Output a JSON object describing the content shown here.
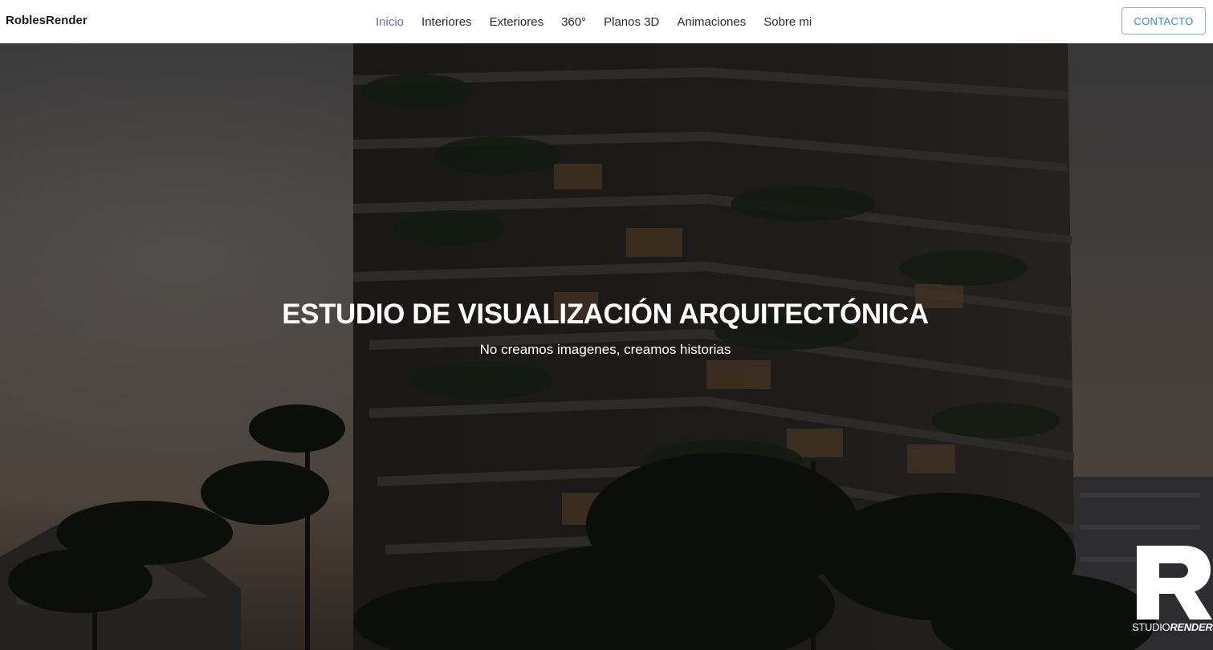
{
  "brand": {
    "name": "RoblesRender"
  },
  "nav": {
    "items": [
      {
        "label": "Inicio",
        "active": true
      },
      {
        "label": "Interiores",
        "active": false
      },
      {
        "label": "Exteriores",
        "active": false
      },
      {
        "label": "360°",
        "active": false
      },
      {
        "label": "Planos 3D",
        "active": false
      },
      {
        "label": "Animaciones",
        "active": false
      },
      {
        "label": "Sobre mi",
        "active": false
      }
    ],
    "active_color": "#6c63c7"
  },
  "contact_button": {
    "label": "CONTACTO",
    "color": "#3a8dc2"
  },
  "hero": {
    "title": "ESTUDIO DE VISUALIZACIÓN ARQUITECTÓNICA",
    "subtitle": "No creamos imagenes, creamos historias"
  },
  "logo": {
    "mark": "R",
    "text_light": "STUDIO",
    "text_bold": "RENDER"
  }
}
